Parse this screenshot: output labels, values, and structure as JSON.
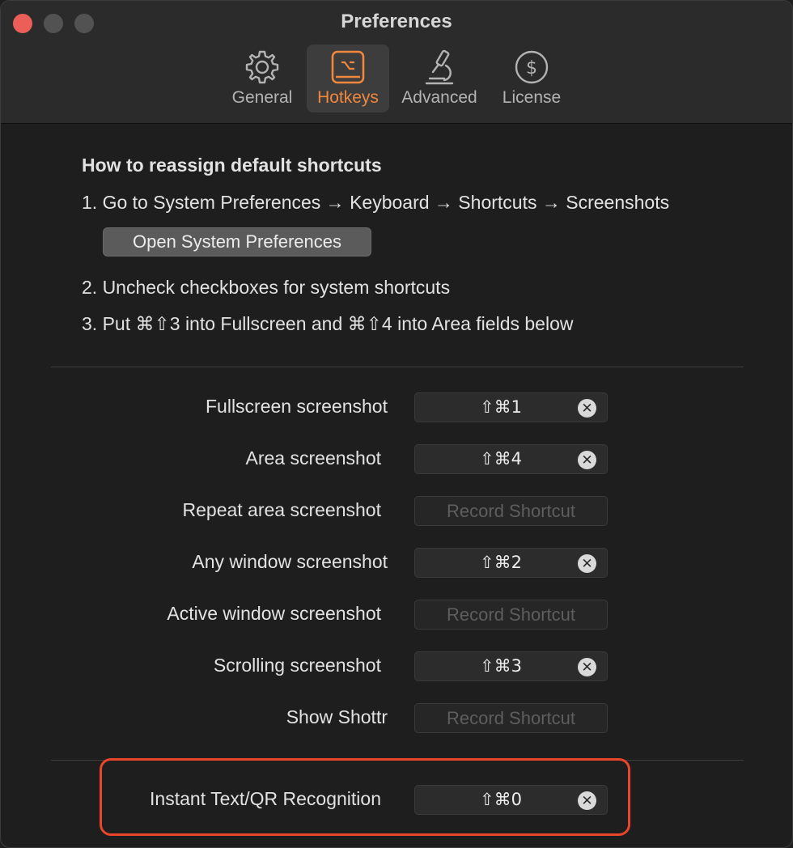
{
  "window": {
    "title": "Preferences"
  },
  "tabs": [
    {
      "label": "General",
      "icon": "gear-icon",
      "active": false
    },
    {
      "label": "Hotkeys",
      "icon": "keyboard-key-icon",
      "active": true
    },
    {
      "label": "Advanced",
      "icon": "microscope-icon",
      "active": false
    },
    {
      "label": "License",
      "icon": "dollar-circle-icon",
      "active": false
    }
  ],
  "instructions": {
    "heading": "How to reassign default shortcuts",
    "step1": "1. Go to System Preferences → Keyboard → Shortcuts → Screenshots",
    "open_button": "Open System Preferences",
    "step2": "2. Uncheck checkboxes for system shortcuts",
    "step3": "3. Put ⌘⇧3 into Fullscreen and ⌘⇧4 into Area fields below"
  },
  "shortcuts": [
    {
      "label": "Fullscreen screenshot",
      "value": "⇧⌘1"
    },
    {
      "label": "Area screenshot",
      "value": "⇧⌘4"
    },
    {
      "label": "Repeat area screenshot",
      "placeholder": "Record Shortcut"
    },
    {
      "label": "Any window screenshot",
      "value": "⇧⌘2"
    },
    {
      "label": "Active window screenshot",
      "placeholder": "Record Shortcut"
    },
    {
      "label": "Scrolling screenshot",
      "value": "⇧⌘3"
    },
    {
      "label": "Show Shottr",
      "placeholder": "Record Shortcut"
    }
  ],
  "ocr_shortcut": {
    "label": "Instant Text/QR Recognition",
    "value": "⇧⌘0"
  },
  "colors": {
    "accent": "#f0873d",
    "highlight": "#e8452a",
    "close": "#ec5f58"
  }
}
